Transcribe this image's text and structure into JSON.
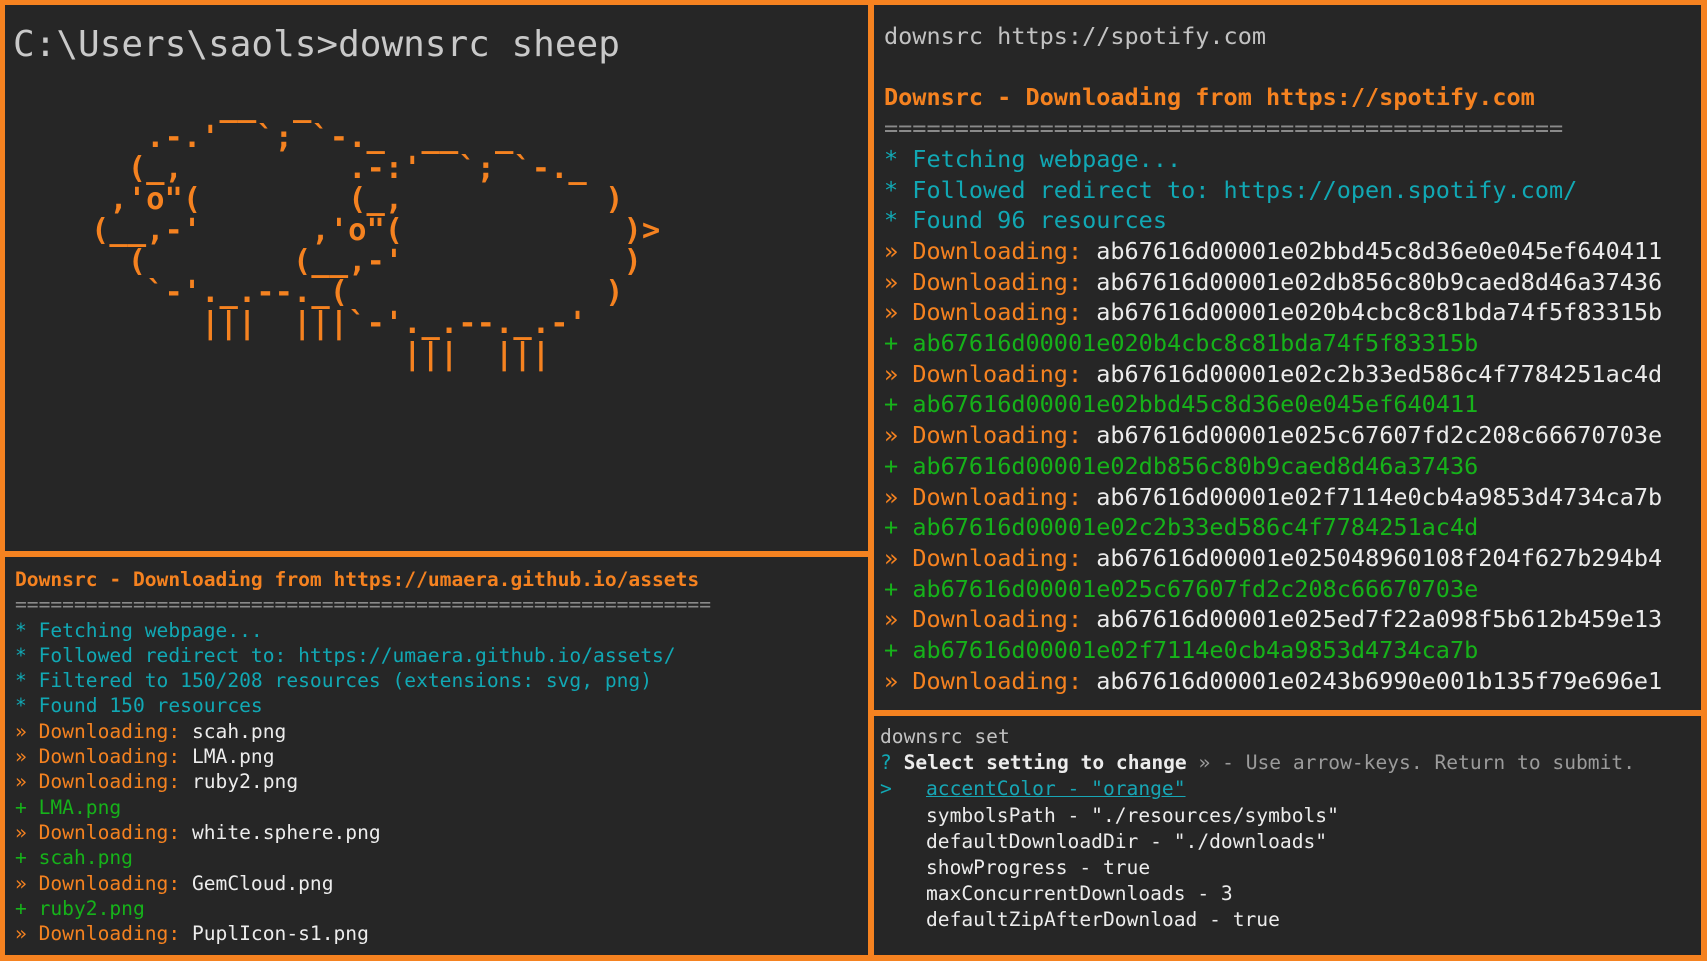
{
  "sheep_pane": {
    "command": "C:\\Users\\saols>downsrc sheep",
    "ascii_art": "       __  _\n   .-.'  `; `-._  __  _\n  (_,         .-:'  `; `-._\n ,'o\"(        (_,           )\n(__,-'      ,'o\"(            )>\n  (        (__,-'            )\n   `-'._.--._(              )\n      |||  |||`-'._.--._.-'\n                 |||  |||"
  },
  "assets_pane": {
    "header": "Downsrc - Downloading from https://umaera.github.io/assets",
    "separator": "===========================================================",
    "info": [
      "* Fetching webpage...",
      "* Followed redirect to: https://umaera.github.io/assets/",
      "* Filtered to 150/208 resources (extensions: svg, png)",
      "* Found 150 resources"
    ],
    "download_label": "Downloading:",
    "download_marker": "»",
    "done_marker": "+",
    "events": [
      {
        "kind": "download",
        "file": "scah.png"
      },
      {
        "kind": "download",
        "file": "LMA.png"
      },
      {
        "kind": "download",
        "file": "ruby2.png"
      },
      {
        "kind": "done",
        "file": "LMA.png"
      },
      {
        "kind": "download",
        "file": "white.sphere.png"
      },
      {
        "kind": "done",
        "file": "scah.png"
      },
      {
        "kind": "download",
        "file": "GemCloud.png"
      },
      {
        "kind": "done",
        "file": "ruby2.png"
      },
      {
        "kind": "download",
        "file": "PuplIcon-s1.png"
      }
    ]
  },
  "spotify_pane": {
    "command": "downsrc https://spotify.com",
    "header": "Downsrc - Downloading from https://spotify.com",
    "separator": "================================================",
    "info": [
      "* Fetching webpage...",
      "* Followed redirect to: https://open.spotify.com/",
      "* Found 96 resources"
    ],
    "download_label": "Downloading:",
    "download_marker": "»",
    "done_marker": "+",
    "events": [
      {
        "kind": "download",
        "file": "ab67616d00001e02bbd45c8d36e0e045ef640411"
      },
      {
        "kind": "download",
        "file": "ab67616d00001e02db856c80b9caed8d46a37436"
      },
      {
        "kind": "download",
        "file": "ab67616d00001e020b4cbc8c81bda74f5f83315b"
      },
      {
        "kind": "done",
        "file": "ab67616d00001e020b4cbc8c81bda74f5f83315b"
      },
      {
        "kind": "download",
        "file": "ab67616d00001e02c2b33ed586c4f7784251ac4d"
      },
      {
        "kind": "done",
        "file": "ab67616d00001e02bbd45c8d36e0e045ef640411"
      },
      {
        "kind": "download",
        "file": "ab67616d00001e025c67607fd2c208c66670703e"
      },
      {
        "kind": "done",
        "file": "ab67616d00001e02db856c80b9caed8d46a37436"
      },
      {
        "kind": "download",
        "file": "ab67616d00001e02f7114e0cb4a9853d4734ca7b"
      },
      {
        "kind": "done",
        "file": "ab67616d00001e02c2b33ed586c4f7784251ac4d"
      },
      {
        "kind": "download",
        "file": "ab67616d00001e025048960108f204f627b294b4"
      },
      {
        "kind": "done",
        "file": "ab67616d00001e025c67607fd2c208c66670703e"
      },
      {
        "kind": "download",
        "file": "ab67616d00001e025ed7f22a098f5b612b459e13"
      },
      {
        "kind": "done",
        "file": "ab67616d00001e02f7114e0cb4a9853d4734ca7b"
      },
      {
        "kind": "download",
        "file": "ab67616d00001e0243b6990e001b135f79e696e1"
      }
    ]
  },
  "settings_pane": {
    "command": "downsrc set",
    "question_mark": "?",
    "question": "Select setting to change",
    "hint_marker": "»",
    "hint": "- Use arrow-keys. Return to submit.",
    "cursor": ">",
    "options": [
      "accentColor - \"orange\"",
      "symbolsPath - \"./resources/symbols\"",
      "defaultDownloadDir - \"./downloads\"",
      "showProgress - true",
      "maxConcurrentDownloads - 3",
      "defaultZipAfterDownload - true"
    ],
    "selected_index": 0
  },
  "colors": {
    "accent": "#f58220",
    "background": "#262626",
    "info": "#11a8b4",
    "success": "#16b21a",
    "text": "#ececec"
  }
}
